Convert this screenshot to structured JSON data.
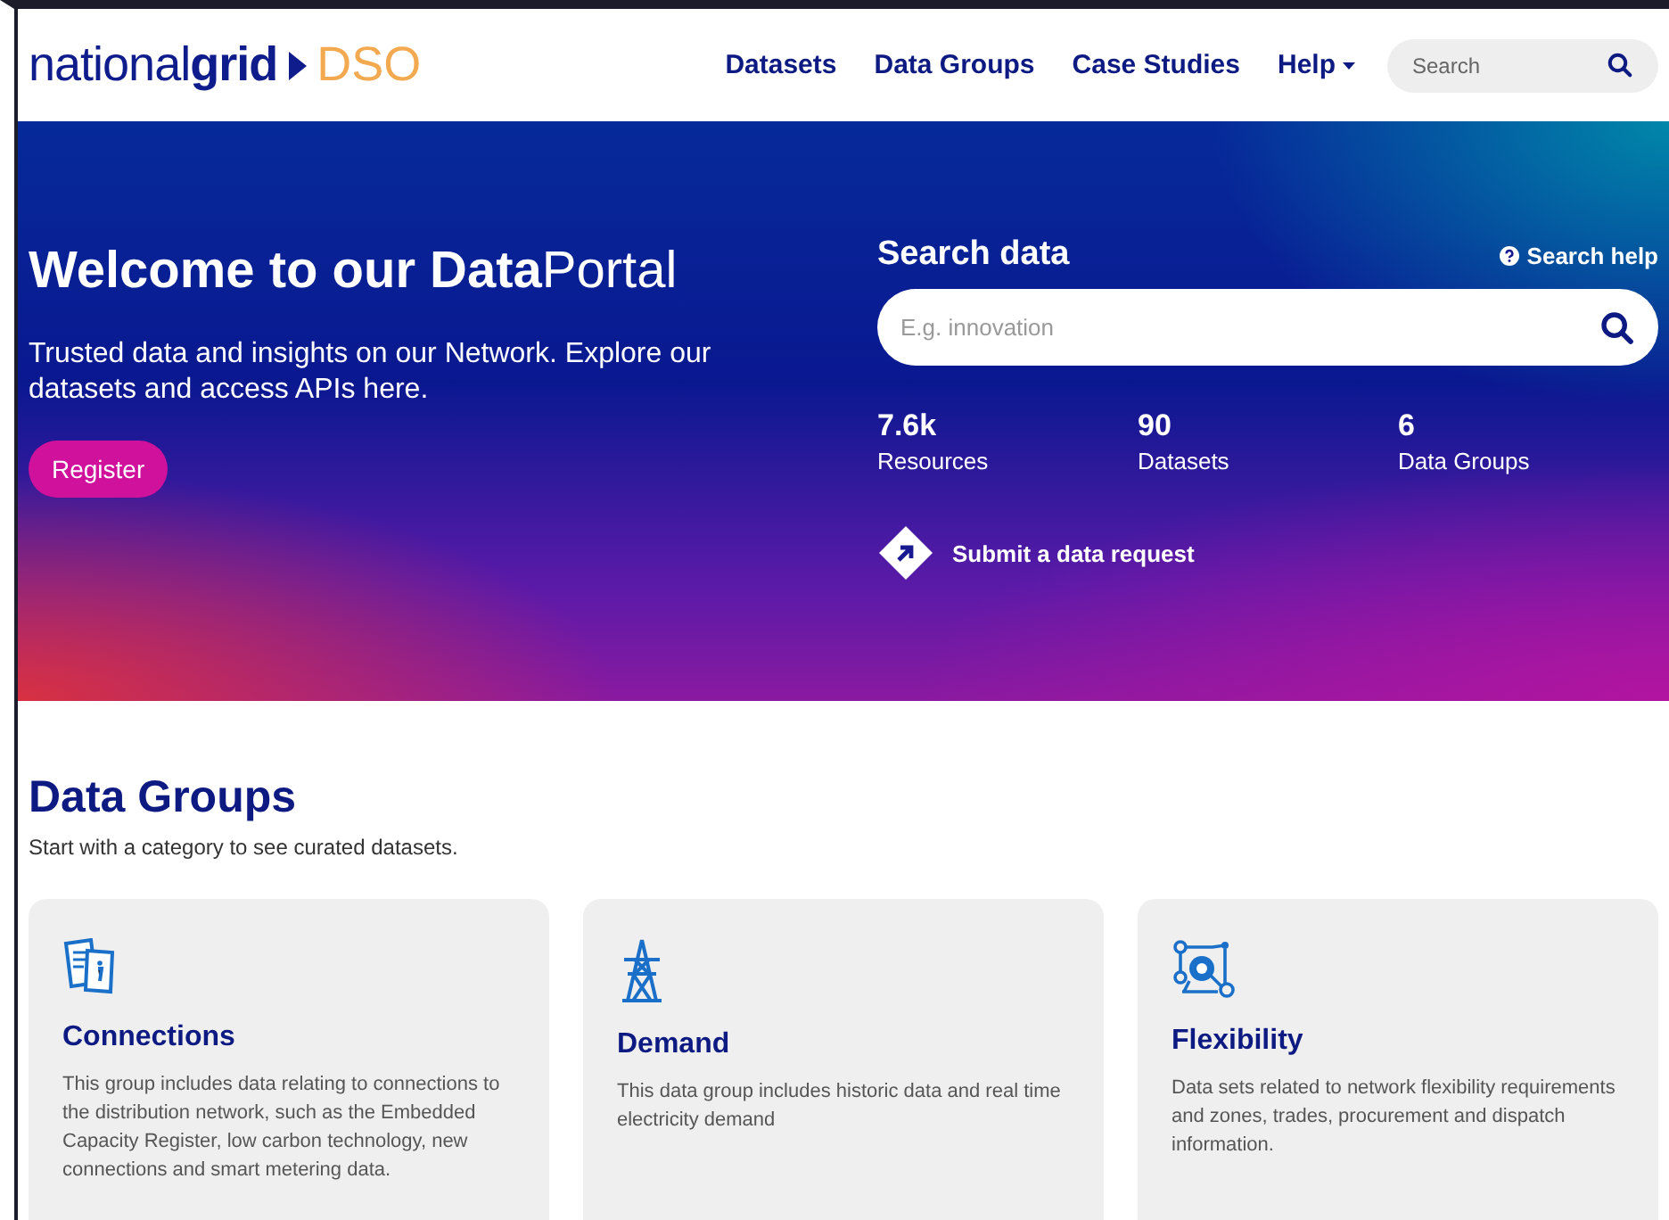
{
  "header": {
    "logo_text": "national**grid**",
    "logo_suffix": "DSO",
    "nav": [
      {
        "label": "Datasets",
        "kind": "link"
      },
      {
        "label": "Data Groups",
        "kind": "link"
      },
      {
        "label": "Case Studies",
        "kind": "link"
      },
      {
        "label": "Help",
        "kind": "dropdown"
      }
    ],
    "search": {
      "placeholder": "Search"
    }
  },
  "hero": {
    "title": "**Welcome to our Data**Portal",
    "subtitle": "Trusted data and insights on our Network. Explore our datasets and access APIs here.",
    "register": "Register",
    "search_title": "Search data",
    "search_help": "Search help",
    "search_placeholder": "E.g. innovation",
    "stats": [
      {
        "value": "7.6k",
        "label": "Resources"
      },
      {
        "value": "90",
        "label": "Datasets"
      },
      {
        "value": "6",
        "label": "Data Groups"
      }
    ],
    "request": "Submit a data request"
  },
  "data_groups": {
    "title": "Data Groups",
    "subtitle": "Start with a category to see curated datasets.",
    "cards": [
      {
        "kind": "connections",
        "title": "Connections",
        "text": "This group includes data relating to connections to the distribution network, such as the Embedded Capacity Register, low carbon technology, new connections and smart metering data."
      },
      {
        "kind": "demand",
        "title": "Demand",
        "text": "This data group includes historic data and real time electricity demand"
      },
      {
        "kind": "flexibility",
        "title": "Flexibility",
        "text": "Data sets related to network flexibility requirements and zones, trades, procurement and dispatch information."
      }
    ]
  }
}
